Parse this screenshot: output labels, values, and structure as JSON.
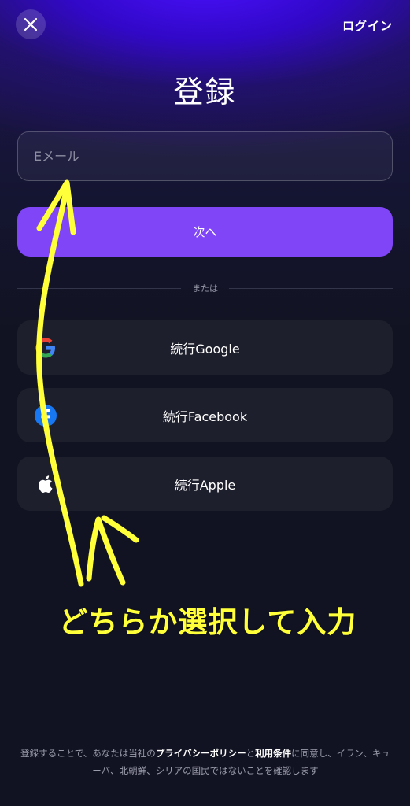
{
  "header": {
    "close_icon": "close-icon",
    "login_label": "ログイン"
  },
  "page": {
    "title": "登録"
  },
  "form": {
    "email_placeholder": "Eメール",
    "email_value": "",
    "next_label": "次へ"
  },
  "divider": {
    "label": "または"
  },
  "social": [
    {
      "label": "続行Google",
      "icon": "google-icon"
    },
    {
      "label": "続行Facebook",
      "icon": "facebook-icon"
    },
    {
      "label": "続行Apple",
      "icon": "apple-icon"
    }
  ],
  "annotation": {
    "text": "どちらか選択して入力",
    "color": "#ffff3a"
  },
  "footer": {
    "prefix": "登録することで、あなたは当社の",
    "privacy_link": "プライバシーポリシー",
    "and": "と",
    "terms_link": "利用条件",
    "suffix": "に同意し、イラン、キューバ、北朝鮮、シリアの国民ではないことを確認します"
  },
  "colors": {
    "accent": "#7f45f6",
    "background": "#121322",
    "button": "#1e1f2c"
  }
}
